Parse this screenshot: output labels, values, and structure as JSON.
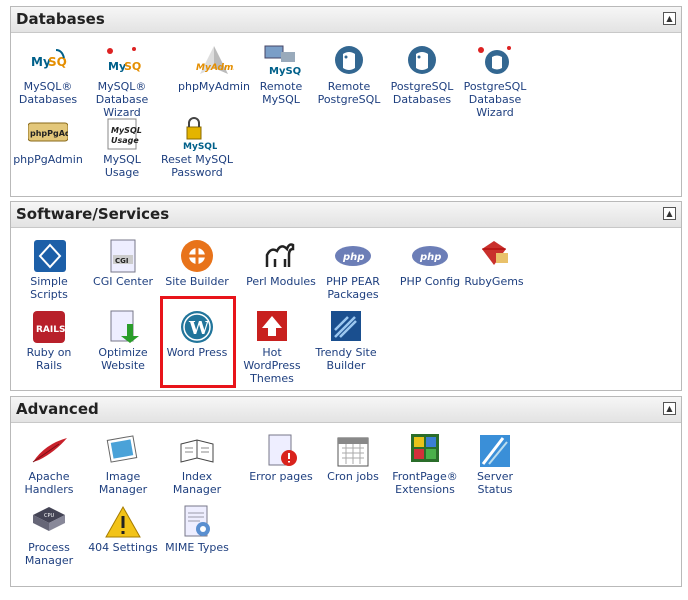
{
  "databases": {
    "title": "Databases",
    "items": [
      {
        "label": "MySQL® Databases",
        "icon": "mysql-icon"
      },
      {
        "label": "MySQL® Database Wizard",
        "icon": "mysql-wizard-icon"
      },
      {
        "label": "phpMyAdmin",
        "icon": "phpmyadmin-icon"
      },
      {
        "label": "Remote MySQL",
        "icon": "remote-mysql-icon"
      },
      {
        "label": "Remote PostgreSQL",
        "icon": "postgresql-elephant-icon"
      },
      {
        "label": "PostgreSQL Databases",
        "icon": "postgresql-elephant-icon"
      },
      {
        "label": "PostgreSQL Database Wizard",
        "icon": "postgresql-wizard-icon"
      },
      {
        "label": "phpPgAdmin",
        "icon": "phppgadmin-icon"
      },
      {
        "label": "MySQL Usage",
        "icon": "mysql-usage-icon"
      },
      {
        "label": "Reset MySQL Password",
        "icon": "mysql-lock-icon"
      }
    ]
  },
  "software": {
    "title": "Software/Services",
    "items": [
      {
        "label": "Simple Scripts",
        "icon": "simple-scripts-icon"
      },
      {
        "label": "CGI Center",
        "icon": "cgi-document-icon"
      },
      {
        "label": "Site Builder",
        "icon": "site-builder-icon"
      },
      {
        "label": "Perl Modules",
        "icon": "perl-camel-icon"
      },
      {
        "label": "PHP PEAR Packages",
        "icon": "php-icon"
      },
      {
        "label": "PHP Config",
        "icon": "php-icon"
      },
      {
        "label": "RubyGems",
        "icon": "ruby-gem-icon"
      },
      {
        "label": "Ruby on Rails",
        "icon": "rails-icon"
      },
      {
        "label": "Optimize Website",
        "icon": "optimize-icon"
      },
      {
        "label": "Word Press",
        "icon": "wordpress-icon"
      },
      {
        "label": "Hot WordPress Themes",
        "icon": "hot-themes-icon"
      },
      {
        "label": "Trendy Site Builder",
        "icon": "trendy-builder-icon"
      }
    ]
  },
  "advanced": {
    "title": "Advanced",
    "items": [
      {
        "label": "Apache Handlers",
        "icon": "apache-feather-icon"
      },
      {
        "label": "Image Manager",
        "icon": "image-manager-icon"
      },
      {
        "label": "Index Manager",
        "icon": "index-book-icon"
      },
      {
        "label": "Error pages",
        "icon": "error-page-icon"
      },
      {
        "label": "Cron jobs",
        "icon": "calendar-icon"
      },
      {
        "label": "FrontPage® Extensions",
        "icon": "frontpage-icon"
      },
      {
        "label": "Server Status",
        "icon": "server-status-icon"
      },
      {
        "label": "Process Manager",
        "icon": "cpu-chip-icon"
      },
      {
        "label": "404 Settings",
        "icon": "warning-icon"
      },
      {
        "label": "MIME Types",
        "icon": "mime-document-icon"
      }
    ]
  },
  "colors": {
    "highlight": "#e8141a",
    "label": "#1e3f7f"
  }
}
